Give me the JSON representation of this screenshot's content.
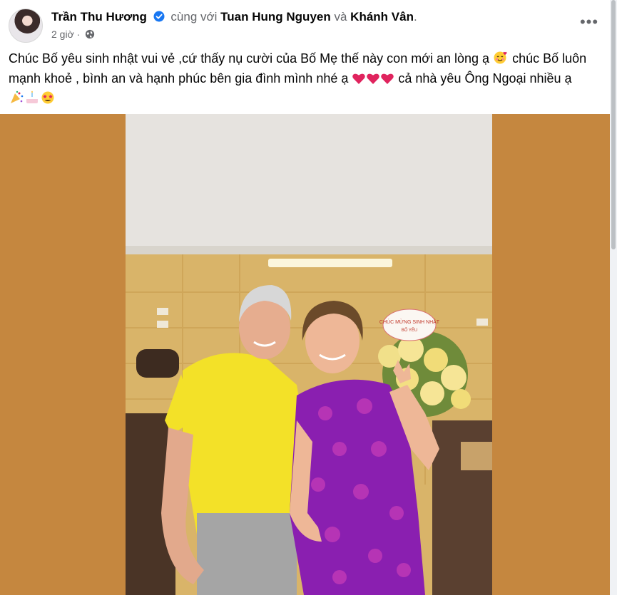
{
  "post": {
    "author": "Trần Thu Hương",
    "with_text": "cùng với",
    "tagged_1": "Tuan Hung Nguyen",
    "and_text": "và",
    "tagged_2": "Khánh Vân",
    "end_punct": ".",
    "time": "2 giờ",
    "separator": "·",
    "more_label": "•••",
    "caption_part1": "Chúc Bố yêu sinh nhật vui vẻ ,cứ thấy nụ cười của Bố Mẹ thế này con mới an lòng ạ",
    "caption_part2": "chúc Bố luôn mạnh khoẻ , bình an và hạnh phúc bên gia đình mình nhé ạ",
    "caption_part3": "cả nhà yêu Ông Ngoại nhiều ạ",
    "photo_sign_line1": "CHÚC MỪNG SINH NHẬT",
    "photo_sign_line2": "BỐ YÊU"
  },
  "colors": {
    "media_background": "#c5873f",
    "verified_badge": "#1877f2",
    "heart": "#e0245e"
  },
  "icons": [
    "verified-badge-icon",
    "globe-icon",
    "more-options-icon",
    "smiling-face-with-hearts-icon",
    "heart-icon",
    "confetti-icon",
    "birthday-cake-icon",
    "star-struck-icon"
  ]
}
